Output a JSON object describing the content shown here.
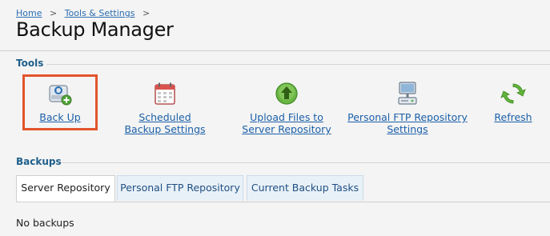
{
  "breadcrumb": {
    "home": "Home",
    "separator": ">",
    "parent": "Tools & Settings",
    "trail_end": ">"
  },
  "page": {
    "title": "Backup Manager"
  },
  "tools_section": {
    "label": "Tools",
    "items": [
      {
        "label": "Back Up",
        "icon": "backup-drive-icon"
      },
      {
        "label": "Scheduled Backup Settings",
        "icon": "calendar-icon"
      },
      {
        "label": "Upload Files to Server Repository",
        "icon": "upload-icon"
      },
      {
        "label": "Personal FTP Repository Settings",
        "icon": "ftp-repository-icon"
      },
      {
        "label": "Refresh",
        "icon": "refresh-icon"
      }
    ]
  },
  "backups_section": {
    "label": "Backups",
    "tabs": [
      {
        "label": "Server Repository",
        "active": true
      },
      {
        "label": "Personal FTP Repository",
        "active": false
      },
      {
        "label": "Current Backup Tasks",
        "active": false
      }
    ],
    "empty_message": "No backups"
  },
  "colors": {
    "link": "#1b5fa8",
    "section_heading": "#1f5f8b",
    "highlight": "#e2542c"
  }
}
